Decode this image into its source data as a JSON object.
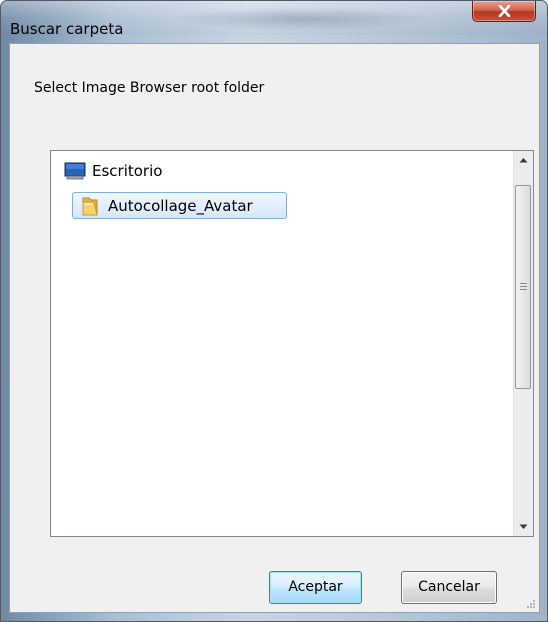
{
  "window": {
    "title": "Buscar carpeta",
    "close_label": "x"
  },
  "dialog": {
    "instruction": "Select Image Browser root folder"
  },
  "tree": {
    "items": [
      {
        "label": "Escritorio",
        "icon": "desktop-icon",
        "selected": false
      },
      {
        "label": "Autocollage_Avatar",
        "icon": "folder-icon",
        "selected": true
      }
    ]
  },
  "buttons": {
    "ok_label": "Aceptar",
    "cancel_label": "Cancelar"
  },
  "colors": {
    "selection_border": "#84acdd",
    "default_button_border": "#3c7fb1",
    "close_button": "#c7533c"
  }
}
